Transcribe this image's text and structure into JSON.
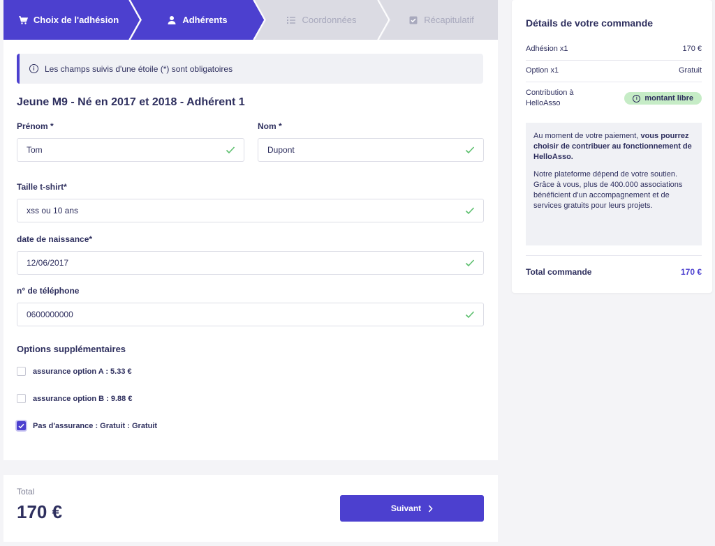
{
  "stepper": {
    "steps": [
      {
        "label": "Choix de l'adhésion",
        "icon": "cart-icon",
        "state": "done"
      },
      {
        "label": "Adhérents",
        "icon": "user-icon",
        "state": "current"
      },
      {
        "label": "Coordonnées",
        "icon": "list-icon",
        "state": "todo"
      },
      {
        "label": "Récapitulatif",
        "icon": "checkbox-icon",
        "state": "todo"
      }
    ]
  },
  "notice": "Les champs suivis d'une étoile (*) sont obligatoires",
  "section_title": "Jeune M9 - Né en 2017 et 2018 - Adhérent 1",
  "form": {
    "prenom_label": "Prénom *",
    "prenom_value": "Tom",
    "nom_label": "Nom *",
    "nom_value": "Dupont",
    "taille_label": "Taille t-shirt*",
    "taille_value": "xss ou 10 ans",
    "naissance_label": "date de naissance*",
    "naissance_value": "12/06/2017",
    "telephone_label": "n° de téléphone",
    "telephone_value": "0600000000"
  },
  "options": {
    "title": "Options supplémentaires",
    "items": [
      {
        "label": "assurance option A : 5.33 €",
        "checked": false
      },
      {
        "label": "assurance option B : 9.88 €",
        "checked": false
      },
      {
        "label": "Pas d'assurance : Gratuit : Gratuit",
        "checked": true
      }
    ]
  },
  "footer": {
    "total_label": "Total",
    "total_amount": "170 €",
    "next_label": "Suivant"
  },
  "order": {
    "title": "Détails de votre commande",
    "adhesion_label": "Adhésion x1",
    "adhesion_value": "170 €",
    "option_label": "Option x1",
    "option_value": "Gratuit",
    "contribution_label": "Contribution à HelloAsso",
    "contribution_badge": "montant libre",
    "info_p1_normal": "Au moment de votre paiement, ",
    "info_p1_bold": "vous pourrez choisir de contribuer au fonctionnement de HelloAsso.",
    "info_p2": "Notre plateforme dépend de votre soutien. Grâce à vous, plus de 400.000 associations bénéficient d'un accompagnement et de services gratuits pour leurs projets.",
    "total_label": "Total commande",
    "total_value": "170 €"
  },
  "colors": {
    "primary": "#4c40cf",
    "step_inactive_bg": "#dbdbe3",
    "success": "#5cbf6e",
    "badge_bg": "#c6ecc6",
    "text": "#2e2f5e"
  }
}
